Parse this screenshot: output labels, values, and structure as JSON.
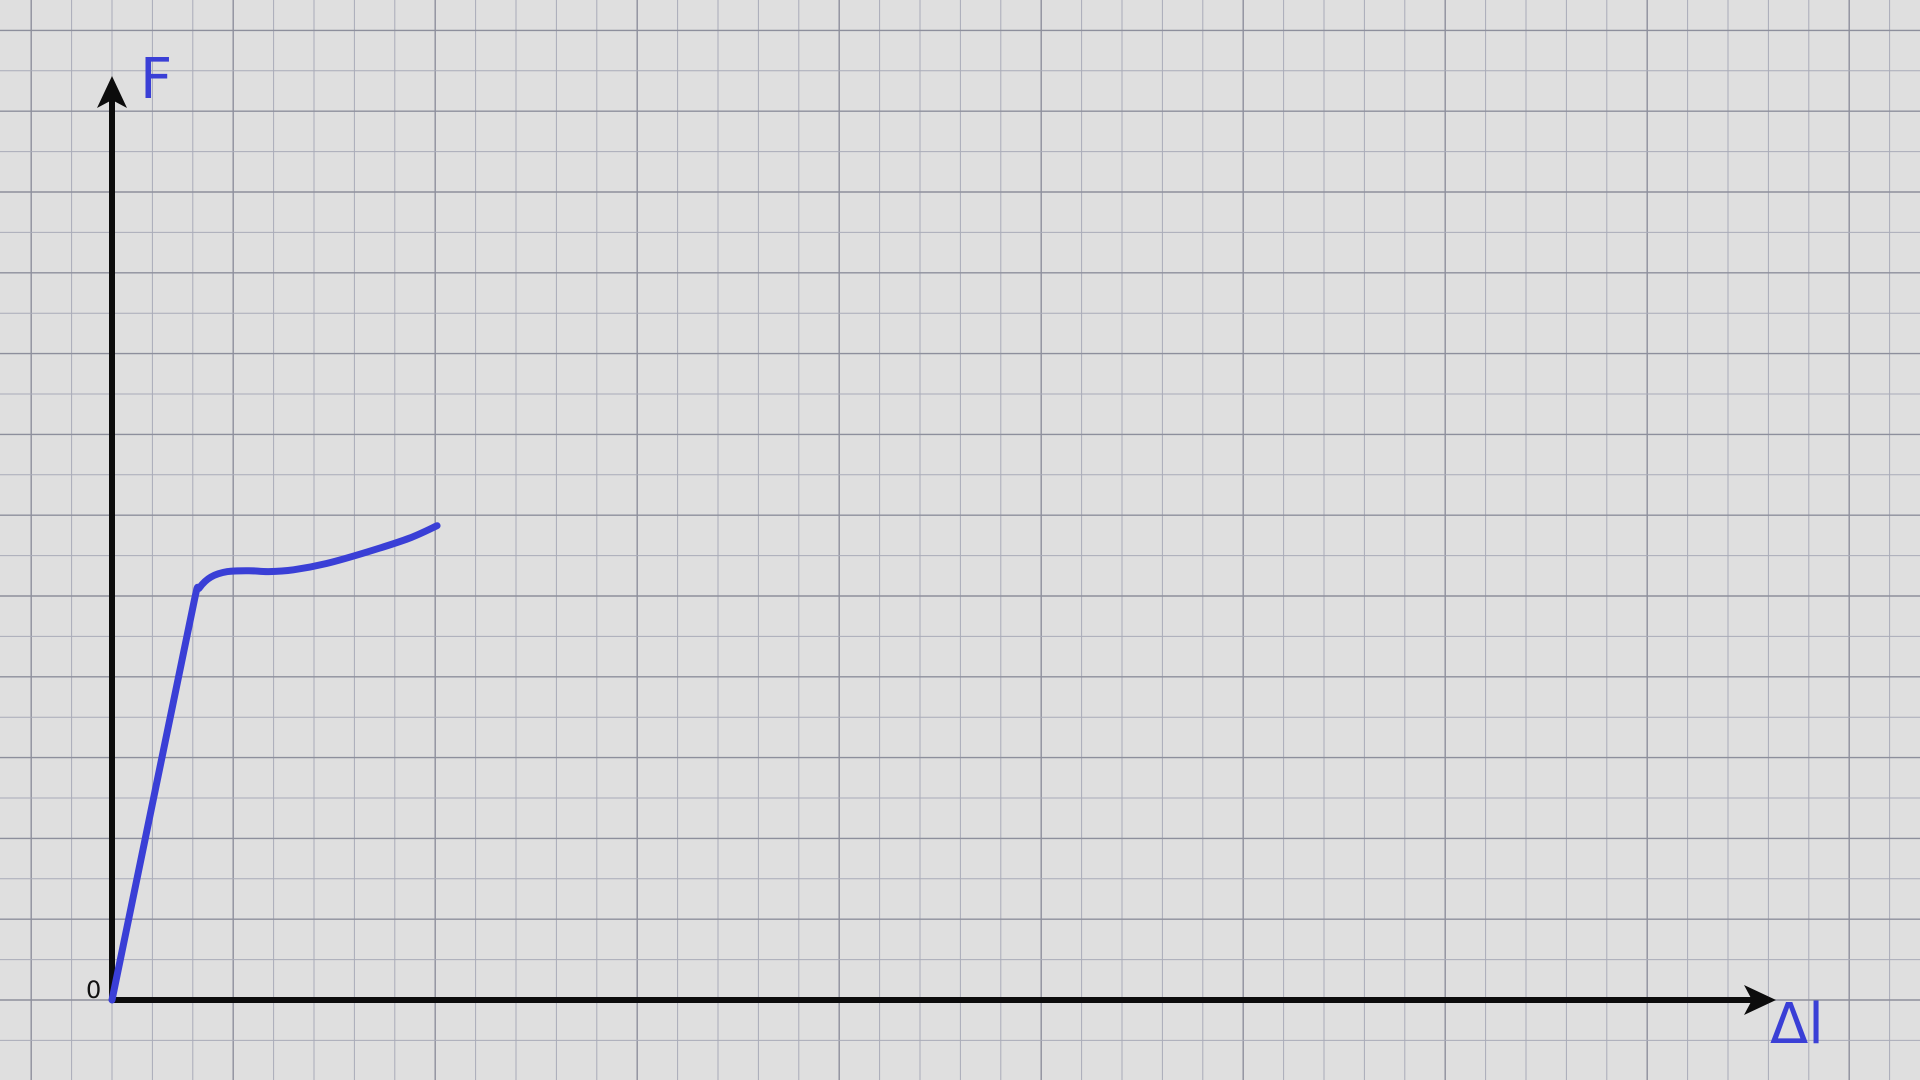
{
  "chart_data": {
    "type": "line",
    "title": "",
    "xlabel": "Δl",
    "ylabel": "F",
    "origin_label": "0",
    "xlim": [
      0,
      100
    ],
    "ylim": [
      0,
      100
    ],
    "grid": true,
    "series": [
      {
        "x": [
          0,
          5.0,
          5.3,
          6.0,
          7.0,
          8.3,
          9.5,
          11.0,
          13.0,
          15.5,
          18.0,
          19.7
        ],
        "y": [
          0,
          44.5,
          45.8,
          47.0,
          47.6,
          47.7,
          47.6,
          47.8,
          48.5,
          49.8,
          51.3,
          52.7
        ]
      }
    ]
  },
  "colors": {
    "background": "#dfdfdf",
    "grid_minor": "#a9abb8",
    "grid_major": "#8d8f9c",
    "axis": "#0c0c0c",
    "curve": "#3a3fd6",
    "axis_label": "#3a3fd6"
  }
}
